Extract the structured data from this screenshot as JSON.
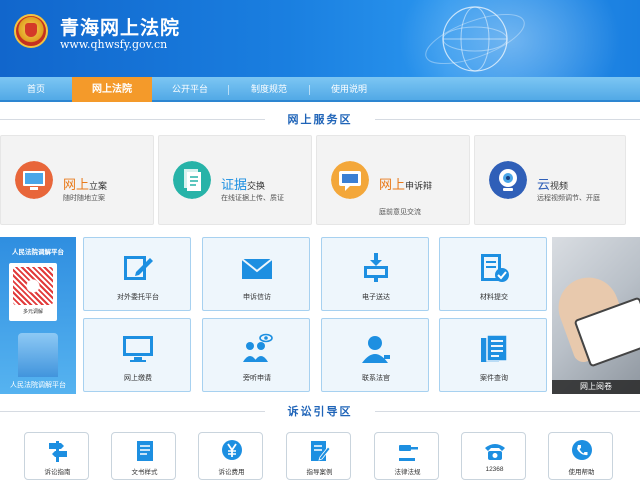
{
  "header": {
    "title": "青海网上法院",
    "url": "www.qhwsfy.gov.cn"
  },
  "nav": {
    "items": [
      "首页",
      "网上法院",
      "公开平台",
      "制度规范",
      "使用说明"
    ],
    "active_index": 1
  },
  "sections": {
    "service": "网上服务区",
    "guide": "诉讼引导区"
  },
  "services": [
    {
      "title_a": "网上",
      "title_b": "立案",
      "desc": "随时随地立案",
      "icon": "computer-icon"
    },
    {
      "title_a": "证据",
      "title_b": "交换",
      "desc": "在线证据上传、质证",
      "icon": "document-icon"
    },
    {
      "title_a": "网上",
      "title_b": "申诉辩",
      "desc": "庭前意见交流",
      "icon": "chat-icon"
    },
    {
      "title_a": "云",
      "title_b": "视频",
      "desc": "远程视频调节、开庭",
      "icon": "webcam-icon"
    }
  ],
  "promo_left": {
    "top": "人民法院调解平台",
    "card_caption": "多元调解",
    "bottom": "人民法院调解平台"
  },
  "promo_right": {
    "label": "网上阅卷"
  },
  "tiles": [
    {
      "label": "对外委托平台",
      "icon": "edit-icon"
    },
    {
      "label": "申诉信访",
      "icon": "mail-icon"
    },
    {
      "label": "电子送达",
      "icon": "download-screen-icon"
    },
    {
      "label": "材料提交",
      "icon": "checklist-icon"
    },
    {
      "label": "网上缴费",
      "icon": "monitor-icon"
    },
    {
      "label": "旁听申请",
      "icon": "audience-icon"
    },
    {
      "label": "联系法官",
      "icon": "user-headset-icon"
    },
    {
      "label": "案件查询",
      "icon": "file-search-icon"
    }
  ],
  "guides": [
    {
      "label": "诉讼指南",
      "icon": "signpost-icon"
    },
    {
      "label": "文书样式",
      "icon": "document-icon"
    },
    {
      "label": "诉讼费用",
      "icon": "yen-icon"
    },
    {
      "label": "指导案例",
      "icon": "edit-document-icon"
    },
    {
      "label": "法律法规",
      "icon": "gavel-icon"
    },
    {
      "label": "12368",
      "icon": "telephone-icon"
    },
    {
      "label": "使用帮助",
      "icon": "phone-circle-icon"
    }
  ],
  "colors": {
    "brand_blue": "#1a7fe0",
    "nav_active": "#f49a2a",
    "tile_icon": "#1d8fe1",
    "service_accent": "#e87a1a"
  }
}
